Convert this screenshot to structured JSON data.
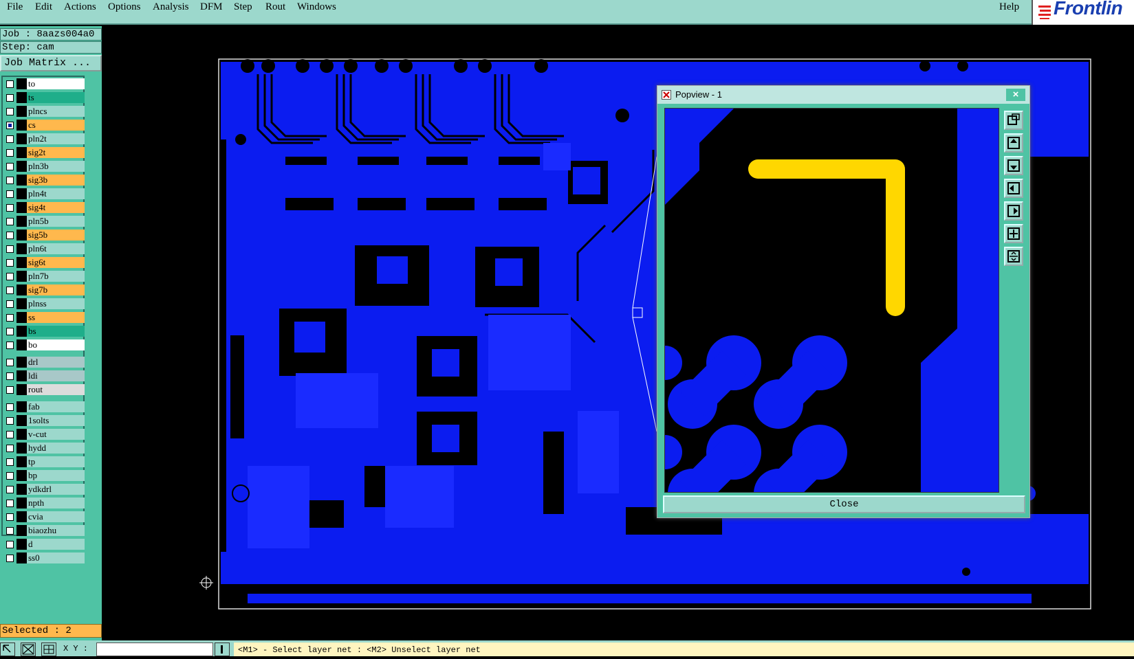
{
  "menubar": {
    "items": [
      "File",
      "Edit",
      "Actions",
      "Options",
      "Analysis",
      "DFM",
      "Step",
      "Rout",
      "Windows"
    ],
    "help": "Help",
    "logo_text": "Frontlin"
  },
  "left": {
    "job": "Job : 8aazs004a0",
    "step": "Step: cam",
    "job_matrix": "Job Matrix ...",
    "selected": "Selected : 2"
  },
  "layers": [
    {
      "name": "to",
      "color": "#ffffff",
      "checked": false
    },
    {
      "name": "ts",
      "color": "#1fae8a",
      "checked": false
    },
    {
      "name": "plncs",
      "color": "#9cd8cc",
      "checked": false
    },
    {
      "name": "cs",
      "color": "#ffb84d",
      "checked": true
    },
    {
      "name": "pln2t",
      "color": "#9cd8cc",
      "checked": false
    },
    {
      "name": "sig2t",
      "color": "#ffb84d",
      "checked": false
    },
    {
      "name": "pln3b",
      "color": "#9cd8cc",
      "checked": false
    },
    {
      "name": "sig3b",
      "color": "#ffb84d",
      "checked": false
    },
    {
      "name": "pln4t",
      "color": "#9cd8cc",
      "checked": false
    },
    {
      "name": "sig4t",
      "color": "#ffb84d",
      "checked": false
    },
    {
      "name": "pln5b",
      "color": "#9cd8cc",
      "checked": false
    },
    {
      "name": "sig5b",
      "color": "#ffb84d",
      "checked": false
    },
    {
      "name": "pln6t",
      "color": "#9cd8cc",
      "checked": false
    },
    {
      "name": "sig6t",
      "color": "#ffb84d",
      "checked": false
    },
    {
      "name": "pln7b",
      "color": "#9cd8cc",
      "checked": false
    },
    {
      "name": "sig7b",
      "color": "#ffb84d",
      "checked": false
    },
    {
      "name": "plnss",
      "color": "#9cd8cc",
      "checked": false
    },
    {
      "name": "ss",
      "color": "#ffb84d",
      "checked": false
    },
    {
      "name": "bs",
      "color": "#1fae8a",
      "checked": false
    },
    {
      "name": "bo",
      "color": "#ffffff",
      "checked": false
    },
    {
      "name": "drl",
      "color": "#a8c8c8",
      "checked": false
    },
    {
      "name": "ldi",
      "color": "#a8c8c8",
      "checked": false
    },
    {
      "name": "rout",
      "color": "#dcdcdc",
      "checked": false
    },
    {
      "name": "fab",
      "color": "#9cd8cc",
      "checked": false
    },
    {
      "name": "1solts",
      "color": "#9cd8cc",
      "checked": false
    },
    {
      "name": "v-cut",
      "color": "#9cd8cc",
      "checked": false
    },
    {
      "name": "hydd",
      "color": "#9cd8cc",
      "checked": false
    },
    {
      "name": "tp",
      "color": "#9cd8cc",
      "checked": false
    },
    {
      "name": "bp",
      "color": "#9cd8cc",
      "checked": false
    },
    {
      "name": "ydkdrl",
      "color": "#9cd8cc",
      "checked": false
    },
    {
      "name": "npth",
      "color": "#9cd8cc",
      "checked": false
    },
    {
      "name": "cvia",
      "color": "#9cd8cc",
      "checked": false
    },
    {
      "name": "biaozhu",
      "color": "#9cd8cc",
      "checked": false
    },
    {
      "name": "d",
      "color": "#9cd8cc",
      "checked": false
    },
    {
      "name": "ss0",
      "color": "#9cd8cc",
      "checked": false
    }
  ],
  "popview": {
    "title": "Popview - 1",
    "close": "Close",
    "close_x": "×"
  },
  "bottom": {
    "xy_label": "X Y :",
    "status": "<M1> - Select layer net : <M2> Unselect layer net"
  },
  "colors": {
    "copper": "#0b1cf0",
    "highlight": "#ffd700",
    "panel": "#4fc3a4",
    "panel_light": "#9cd8cc"
  }
}
